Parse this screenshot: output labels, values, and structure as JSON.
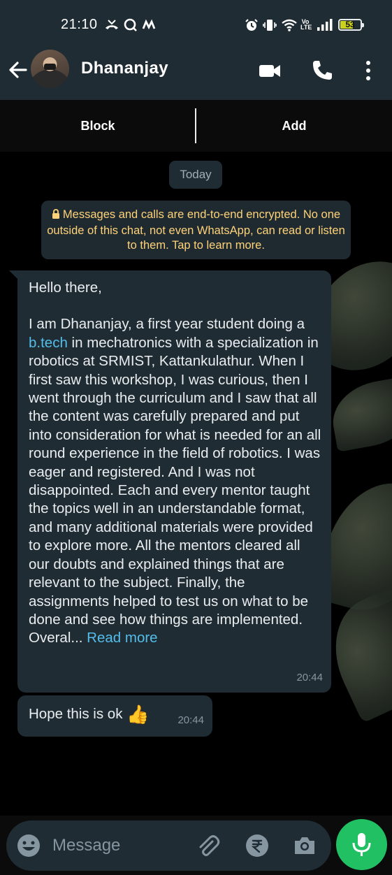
{
  "status_bar": {
    "time": "21:10",
    "battery": "53",
    "network_label": "Vo LTE"
  },
  "header": {
    "contact_name": "Dhananjay"
  },
  "action_bar": {
    "block_label": "Block",
    "add_label": "Add"
  },
  "chat": {
    "day_label": "Today",
    "encryption_notice": "Messages and calls are end-to-end encrypted. No one outside of this chat, not even WhatsApp, can read or listen to them. Tap to learn more.",
    "messages": [
      {
        "greeting": "Hello there,",
        "body_before_link": "I am Dhananjay, a first year student doing a ",
        "link_text": "b.tech",
        "body_after_link": " in mechatronics with a specialization in robotics at SRMIST, Kattankulathur. When I first saw this workshop, I was curious, then I went through the curriculum and I saw that all the content was carefully prepared and put into consideration for what is needed for an all round experience in the field of robotics. I was eager and registered. And I was not disappointed. Each and every mentor taught the topics well in an understandable format, and many additional materials were provided to explore more. All the mentors cleared all our doubts and explained things that are relevant to the subject. Finally, the assignments helped to test us on what to be done and see how things are implemented. Overal... ",
        "read_more": "Read more",
        "time": "20:44"
      },
      {
        "text": "Hope this is ok",
        "emoji": "👍",
        "time": "20:44"
      }
    ]
  },
  "composer": {
    "placeholder": "Message"
  },
  "colors": {
    "header_bg": "#1f2c34",
    "bubble_bg": "#202c33",
    "link": "#53bdeb",
    "encryption_text": "#ffd279",
    "mic_button": "#21c063"
  }
}
